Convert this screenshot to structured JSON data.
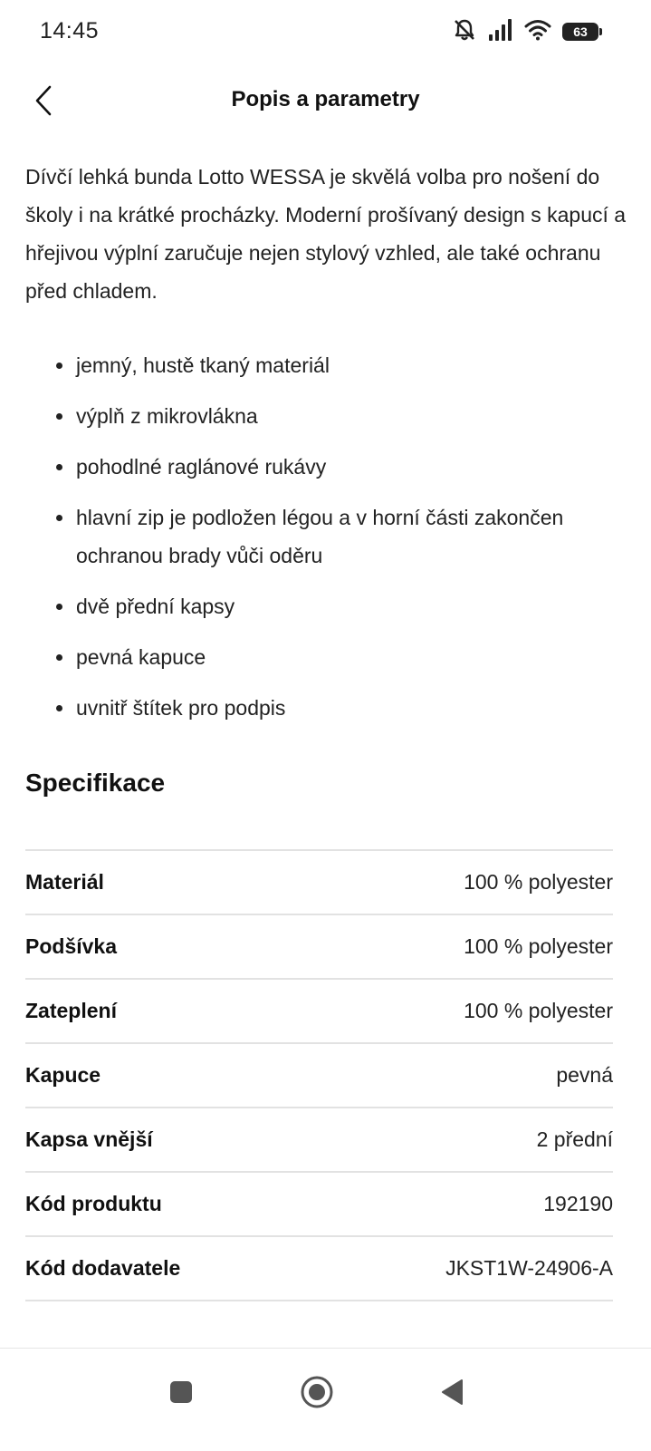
{
  "status_bar": {
    "time": "14:45",
    "battery_level": "63",
    "icons": [
      "bell-off-icon",
      "signal-icon",
      "wifi-icon",
      "battery-icon"
    ]
  },
  "header": {
    "title": "Popis a parametry",
    "back_icon": "chevron-left-icon"
  },
  "description": "Dívčí lehká bunda Lotto WESSA je skvělá volba pro nošení do školy i na krátké procházky. Moderní prošívaný design s kapucí a hřejivou výplní zaručuje nejen stylový vzhled, ale také ochranu před chladem.",
  "features": [
    "jemný, hustě tkaný materiál",
    "výplň z mikrovlákna",
    "pohodlné raglánové rukávy",
    "hlavní zip je podložen légou a v horní části zakončen ochranou brady vůči oděru",
    "dvě přední kapsy",
    "pevná kapuce",
    "uvnitř štítek pro podpis"
  ],
  "specification": {
    "heading": "Specifikace",
    "rows": [
      {
        "label": "Materiál",
        "value": "100 % polyester"
      },
      {
        "label": "Podšívka",
        "value": "100 % polyester"
      },
      {
        "label": "Zateplení",
        "value": "100 % polyester"
      },
      {
        "label": "Kapuce",
        "value": "pevná"
      },
      {
        "label": "Kapsa vnější",
        "value": "2 přední"
      },
      {
        "label": "Kód produktu",
        "value": "192190"
      },
      {
        "label": "Kód dodavatele",
        "value": "JKST1W-24906-A"
      }
    ]
  },
  "nav_bar": {
    "buttons": [
      "recents-square-icon",
      "home-circle-icon",
      "back-triangle-icon"
    ]
  },
  "colors": {
    "text": "#111111",
    "divider": "#e2e2e2",
    "icon": "#222222"
  }
}
